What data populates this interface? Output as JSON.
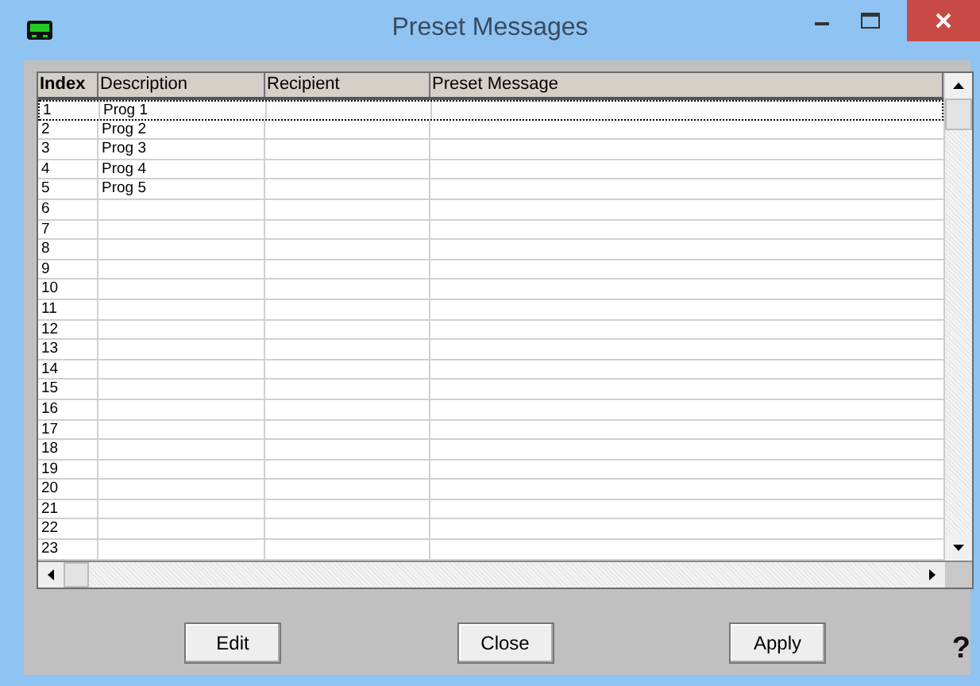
{
  "window": {
    "title": "Preset Messages"
  },
  "table": {
    "columns": [
      "Index",
      "Description",
      "Recipient",
      "Preset Message"
    ],
    "rows": [
      {
        "index": "1",
        "description": "Prog 1",
        "selected": true
      },
      {
        "index": "2",
        "description": "Prog 2",
        "selected": false
      },
      {
        "index": "3",
        "description": "Prog 3",
        "selected": false
      },
      {
        "index": "4",
        "description": "Prog 4",
        "selected": false
      },
      {
        "index": "5",
        "description": "Prog 5",
        "selected": false
      },
      {
        "index": "6",
        "selected": false
      },
      {
        "index": "7",
        "selected": false
      },
      {
        "index": "8",
        "selected": false
      },
      {
        "index": "9",
        "selected": false
      },
      {
        "index": "10",
        "selected": false
      },
      {
        "index": "11",
        "selected": false
      },
      {
        "index": "12",
        "selected": false
      },
      {
        "index": "13",
        "selected": false
      },
      {
        "index": "14",
        "selected": false
      },
      {
        "index": "15",
        "selected": false
      },
      {
        "index": "16",
        "selected": false
      },
      {
        "index": "17",
        "selected": false
      },
      {
        "index": "18",
        "selected": false
      },
      {
        "index": "19",
        "selected": false
      },
      {
        "index": "20",
        "selected": false
      },
      {
        "index": "21",
        "selected": false
      },
      {
        "index": "22",
        "selected": false
      },
      {
        "index": "23",
        "selected": false
      }
    ]
  },
  "buttons": [
    "Edit",
    "Close",
    "Apply"
  ],
  "help": "?"
}
